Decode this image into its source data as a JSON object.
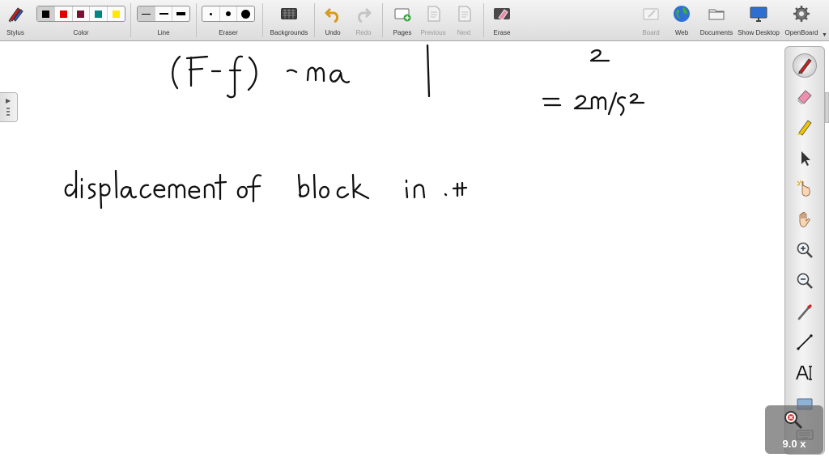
{
  "toolbar": {
    "stylus": "Stylus",
    "color": "Color",
    "line": "Line",
    "eraser": "Eraser",
    "backgrounds": "Backgrounds",
    "undo": "Undo",
    "redo": "Redo",
    "pages": "Pages",
    "previous": "Previous",
    "next": "Next",
    "erase": "Erase",
    "board": "Board",
    "web": "Web",
    "documents": "Documents",
    "show_desktop": "Show Desktop",
    "openboard": "OpenBoard"
  },
  "colors": [
    "#000000",
    "#e00000",
    "#7a1035",
    "#008585",
    "#ffe800"
  ],
  "selected_color": 0,
  "line_widths": [
    "thin",
    "medium",
    "thick"
  ],
  "eraser_sizes": [
    "small",
    "medium",
    "large"
  ],
  "palette_tools": [
    "pen-icon",
    "eraser-tool-icon",
    "highlighter-icon",
    "selector-icon",
    "interact-icon",
    "hand-icon",
    "zoom-in-icon",
    "zoom-out-icon",
    "laser-pointer-icon",
    "line-tool-icon",
    "text-tool-icon",
    "capture-icon",
    "keyboard-icon"
  ],
  "active_tool": "pen-icon",
  "zoom": {
    "label": "9.0 x"
  }
}
